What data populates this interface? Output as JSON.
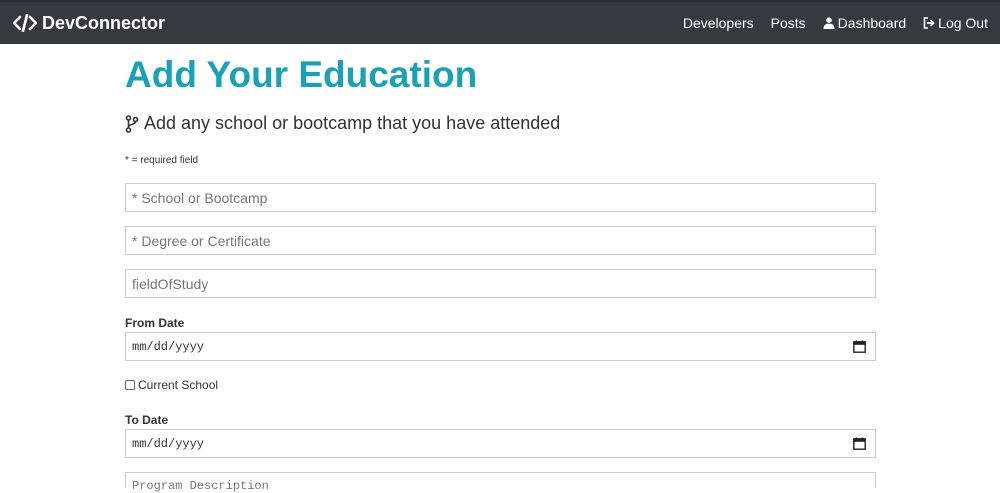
{
  "navbar": {
    "brand": "DevConnector",
    "brand_icon": "code-icon",
    "links": {
      "developers": "Developers",
      "posts": "Posts",
      "dashboard": "Dashboard",
      "logout": "Log Out"
    },
    "colors": {
      "background": "#343a40",
      "text": "#ffffff"
    }
  },
  "page": {
    "title": "Add Your Education",
    "lead": "Add any school or bootcamp that you have attended",
    "required_note": "* = required field",
    "accent_color": "#17a2b8"
  },
  "form": {
    "school_placeholder": "* School or Bootcamp",
    "degree_placeholder": "* Degree or Certificate",
    "field_of_study_placeholder": "fieldOfStudy",
    "from_date_label": "From Date",
    "from_date_placeholder": "mm/dd/yyyy",
    "current_school_label": "Current School",
    "current_school_checked": false,
    "to_date_label": "To Date",
    "to_date_placeholder": "mm/dd/yyyy",
    "description_placeholder": "Program Description"
  }
}
